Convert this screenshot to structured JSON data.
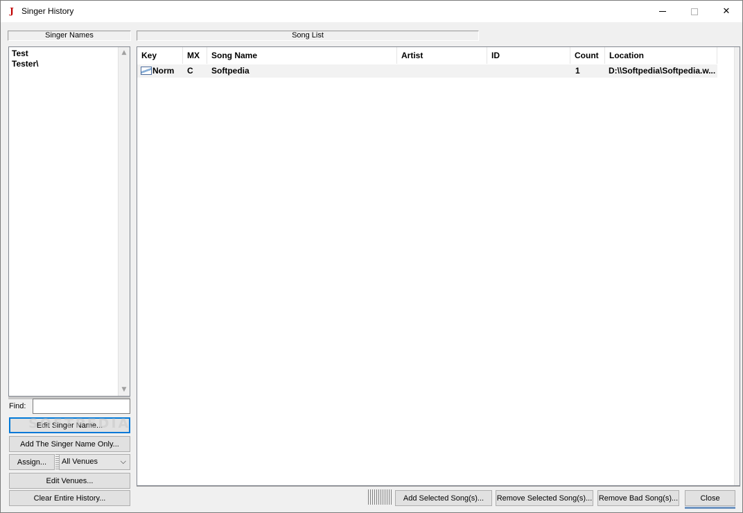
{
  "window": {
    "title": "Singer History",
    "app_icon": "J"
  },
  "left_panel": {
    "header": "Singer Names",
    "singers": [
      "Test",
      "Tester\\"
    ],
    "find_label": "Find:",
    "find_value": "",
    "buttons": {
      "edit_singer": "Edit Singer Name...",
      "add_singer": "Add The Singer Name Only...",
      "assign": "Assign...",
      "edit_venues": "Edit Venues...",
      "clear_history": "Clear Entire History..."
    },
    "venue_select": "All Venues"
  },
  "song_panel": {
    "header": "Song List",
    "columns": [
      "Key",
      "MX",
      "Song Name",
      "Artist",
      "ID",
      "Count",
      "Location"
    ],
    "rows": [
      {
        "key": "Norm",
        "mx": "C",
        "song_name": "Softpedia",
        "artist": "",
        "id": "",
        "count": "1",
        "location": "D:\\\\Softpedia\\Softpedia.w..."
      }
    ]
  },
  "bottom_buttons": {
    "add_selected": "Add Selected Song(s)...",
    "remove_selected": "Remove Selected Song(s)...",
    "remove_bad": "Remove Bad Song(s)...",
    "close": "Close"
  },
  "watermark": "SOFTPEDIA",
  "colors": {
    "focus_blue": "#0078d7",
    "icon_red": "#c00000",
    "button_face": "#e1e1e1"
  }
}
